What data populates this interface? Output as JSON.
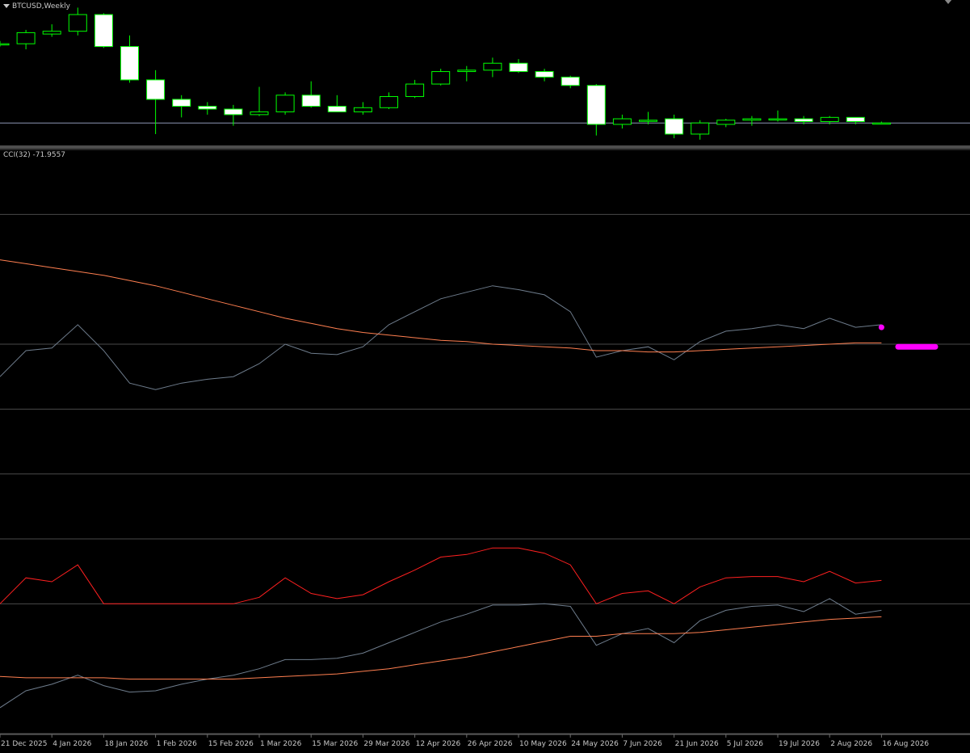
{
  "chart_title": "BTCUSD,Weekly",
  "indicator_title": "CCI(32) -71.9557",
  "colors": {
    "background": "#000000",
    "bull_candle": "#00ff00",
    "bear_candle_body": "#ffffff",
    "grid": "#4a4a4a",
    "price_level": "#8c96b4",
    "cci_line": "#6e7c8c",
    "cci_ma": "#ff7f50",
    "cci_positive": "#ff2020",
    "marker": "#ff00ff"
  },
  "chart_data": [
    {
      "type": "candlestick",
      "title": "BTCUSD,Weekly",
      "ylim": [
        0,
        100
      ],
      "current_level": 15,
      "candles": [
        {
          "o": 72,
          "h": 74,
          "l": 70,
          "c": 72
        },
        {
          "o": 72,
          "h": 82,
          "l": 68,
          "c": 80
        },
        {
          "o": 79,
          "h": 86,
          "l": 77,
          "c": 81
        },
        {
          "o": 81,
          "h": 98,
          "l": 78,
          "c": 93
        },
        {
          "o": 93,
          "h": 94,
          "l": 69,
          "c": 70
        },
        {
          "o": 70,
          "h": 78,
          "l": 44,
          "c": 46
        },
        {
          "o": 46,
          "h": 53,
          "l": 7,
          "c": 32
        },
        {
          "o": 32,
          "h": 35,
          "l": 19,
          "c": 27
        },
        {
          "o": 27,
          "h": 30,
          "l": 21,
          "c": 25
        },
        {
          "o": 25,
          "h": 28,
          "l": 13,
          "c": 21
        },
        {
          "o": 21,
          "h": 41,
          "l": 20,
          "c": 23
        },
        {
          "o": 23,
          "h": 37,
          "l": 21,
          "c": 35
        },
        {
          "o": 35,
          "h": 45,
          "l": 26,
          "c": 27
        },
        {
          "o": 27,
          "h": 35,
          "l": 23,
          "c": 23
        },
        {
          "o": 23,
          "h": 30,
          "l": 21,
          "c": 26
        },
        {
          "o": 26,
          "h": 37,
          "l": 25,
          "c": 34
        },
        {
          "o": 34,
          "h": 46,
          "l": 33,
          "c": 43
        },
        {
          "o": 43,
          "h": 54,
          "l": 42,
          "c": 52
        },
        {
          "o": 52,
          "h": 56,
          "l": 45,
          "c": 53
        },
        {
          "o": 53,
          "h": 62,
          "l": 48,
          "c": 58
        },
        {
          "o": 58,
          "h": 61,
          "l": 51,
          "c": 52
        },
        {
          "o": 52,
          "h": 54,
          "l": 45,
          "c": 48
        },
        {
          "o": 48,
          "h": 49,
          "l": 40,
          "c": 42
        },
        {
          "o": 42,
          "h": 43,
          "l": 6,
          "c": 14
        },
        {
          "o": 14,
          "h": 21,
          "l": 11,
          "c": 18
        },
        {
          "o": 17,
          "h": 23,
          "l": 14,
          "c": 17
        },
        {
          "o": 18,
          "h": 21,
          "l": 4,
          "c": 7
        },
        {
          "o": 7,
          "h": 17,
          "l": 3,
          "c": 15
        },
        {
          "o": 14,
          "h": 18,
          "l": 12,
          "c": 17
        },
        {
          "o": 17,
          "h": 20,
          "l": 13,
          "c": 18
        },
        {
          "o": 18,
          "h": 24,
          "l": 16,
          "c": 18
        },
        {
          "o": 18,
          "h": 20,
          "l": 14,
          "c": 16
        },
        {
          "o": 16,
          "h": 20,
          "l": 14,
          "c": 19
        },
        {
          "o": 19,
          "h": 19,
          "l": 14,
          "c": 16
        },
        {
          "o": 15,
          "h": 16,
          "l": 14,
          "c": 15
        }
      ]
    },
    {
      "type": "line",
      "title": "CCI(32) -71.9557",
      "ylim": [
        -300,
        150
      ],
      "levels": [
        -300,
        -200,
        -150,
        -100,
        -50,
        0,
        100,
        150
      ],
      "series": [
        {
          "values": [
            -25,
            -5,
            -3,
            15,
            -5,
            -30,
            -35,
            -30,
            -27,
            -25,
            -15,
            0,
            -7,
            -8,
            -2,
            15,
            25,
            35,
            40,
            45,
            42,
            38,
            25,
            -10,
            -5,
            -2,
            -12,
            2,
            10,
            12,
            15,
            12,
            20,
            13,
            15
          ]
        },
        {
          "values": [
            65,
            62,
            59,
            56,
            53,
            49,
            45,
            40,
            35,
            30,
            25,
            20,
            16,
            12,
            9,
            7,
            5,
            3,
            2,
            0,
            -1,
            -2,
            -3,
            -5,
            -5,
            -6,
            -6,
            -5,
            -4,
            -3,
            -2,
            -1,
            0,
            1,
            1
          ]
        },
        {
          "values": [
            -200,
            -180,
            -183,
            -170,
            -200,
            -200,
            -200,
            -200,
            -200,
            -200,
            -195,
            -180,
            -192,
            -196,
            -193,
            -183,
            -174,
            -164,
            -162,
            -157,
            -157,
            -161,
            -170,
            -200,
            -192,
            -190,
            -200,
            -187,
            -180,
            -179,
            -179,
            -183,
            -175,
            -184,
            -182
          ]
        },
        {
          "values": [
            -280,
            -267,
            -262,
            -255,
            -263,
            -268,
            -267,
            -262,
            -258,
            -255,
            -250,
            -243,
            -243,
            -242,
            -238,
            -230,
            -222,
            -214,
            -208,
            -201,
            -201,
            -200,
            -202,
            -232,
            -223,
            -219,
            -230,
            -213,
            -205,
            -202,
            -201,
            -206,
            -196,
            -208,
            -205
          ]
        },
        {
          "values": [
            -256,
            -257,
            -257,
            -257,
            -257,
            -258,
            -258,
            -258,
            -258,
            -258,
            -257,
            -256,
            -255,
            -254,
            -252,
            -250,
            -247,
            -244,
            -241,
            -237,
            -233,
            -229,
            -225,
            -225,
            -223,
            -223,
            -223,
            -222,
            -220,
            -218,
            -216,
            -214,
            -212,
            -211,
            -210
          ]
        }
      ],
      "marker_value": 13,
      "marker_bar_value": -2
    }
  ],
  "x_tick_labels": [
    "21 Dec 2025",
    "4 Jan 2026",
    "18 Jan 2026",
    "1 Feb 2026",
    "15 Feb 2026",
    "1 Mar 2026",
    "15 Mar 2026",
    "29 Mar 2026",
    "12 Apr 2026",
    "26 Apr 2026",
    "10 May 2026",
    "24 May 2026",
    "7 Jun 2026",
    "21 Jun 2026",
    "5 Jul 2026",
    "19 Jul 2026",
    "2 Aug 2026",
    "16 Aug 2026"
  ]
}
